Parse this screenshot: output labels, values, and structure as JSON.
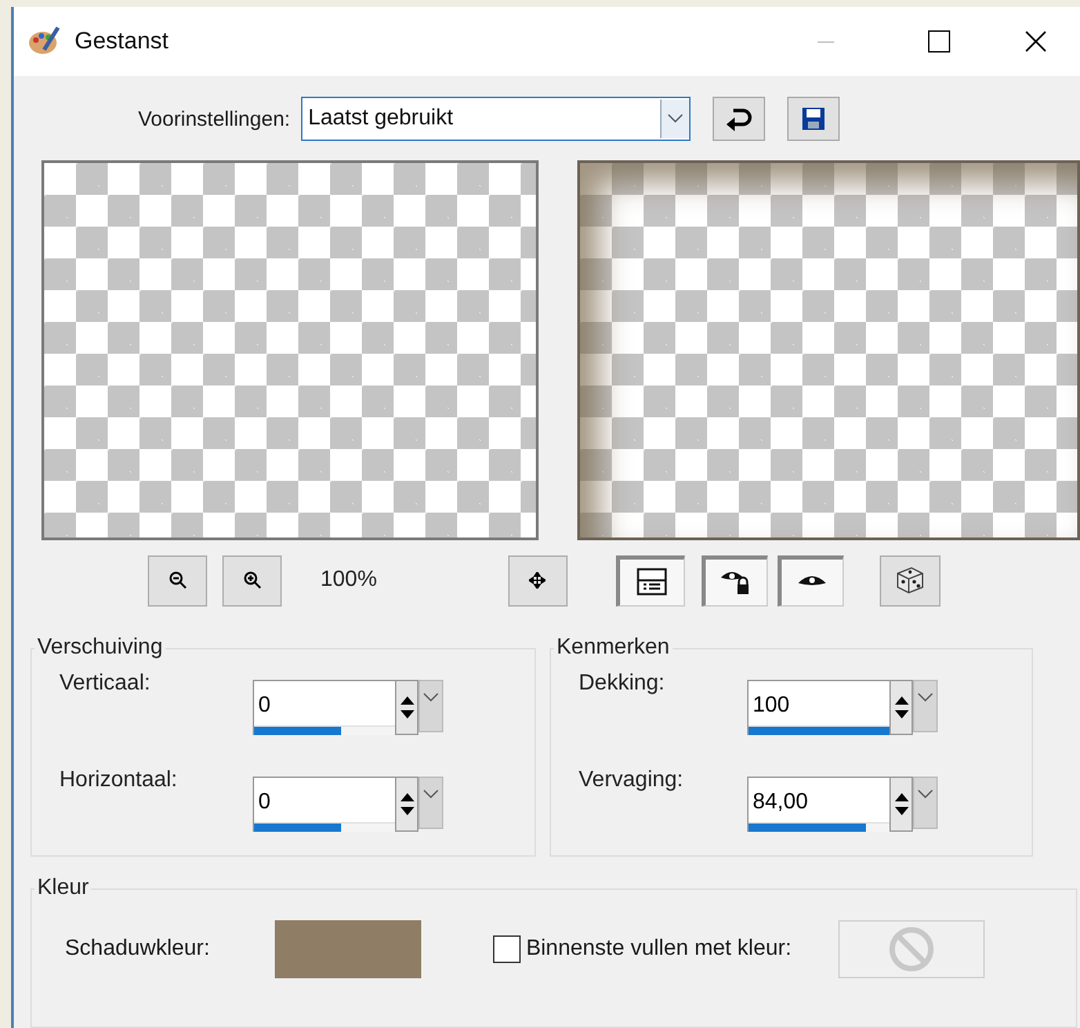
{
  "window": {
    "title": "Gestanst",
    "minimize_disabled": true
  },
  "presets": {
    "label": "Voorinstellingen:",
    "value": "Laatst gebruikt"
  },
  "zoom_text": "100%",
  "toolbar": [
    {
      "kind": "zoom-out",
      "pressed": false
    },
    {
      "kind": "zoom-in",
      "pressed": false
    },
    {
      "kind": "zoom-text"
    },
    {
      "kind": "move",
      "pressed": false
    },
    {
      "kind": "layout",
      "pressed": true
    },
    {
      "kind": "eye-lock",
      "pressed": true
    },
    {
      "kind": "eye",
      "pressed": true
    },
    {
      "kind": "dice",
      "pressed": false
    }
  ],
  "offset_group": {
    "title": "Verschuiving",
    "fields": [
      {
        "label": "Verticaal:",
        "value": "0",
        "level": 0.62
      },
      {
        "label": "Horizontaal:",
        "value": "0",
        "level": 0.62
      }
    ]
  },
  "properties_group": {
    "title": "Kenmerken",
    "fields": [
      {
        "label": "Dekking:",
        "value": "100",
        "level": 1
      },
      {
        "label": "Vervaging:",
        "value": "84,00",
        "level": 0.84
      }
    ]
  },
  "color_group": {
    "title": "Kleur",
    "shadow": {
      "label": "Schaduwkleur:",
      "color": "#8f7e65"
    },
    "fill_inside": {
      "label": "Binnenste vullen met kleur:",
      "checked": false
    }
  }
}
